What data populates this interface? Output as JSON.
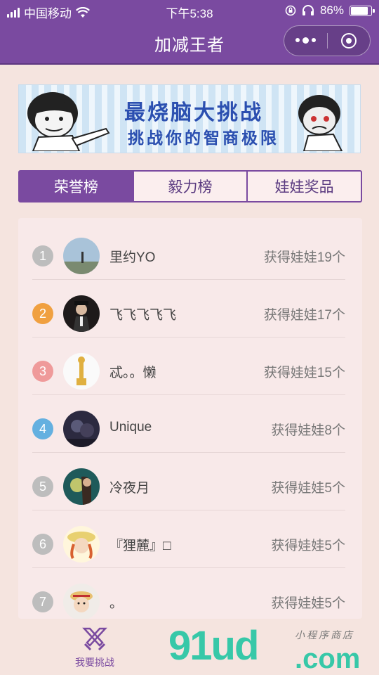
{
  "status_bar": {
    "carrier": "中国移动",
    "time": "下午5:38",
    "battery": "86%",
    "battery_level": 0.86
  },
  "nav": {
    "title": "加减王者"
  },
  "banner": {
    "title": "最烧脑大挑战",
    "subtitle": "挑战你的智商极限"
  },
  "tabs": [
    "荣誉榜",
    "毅力榜",
    "娃娃奖品"
  ],
  "ranking": [
    {
      "rank": "1",
      "name": "里约YO",
      "prize": "获得娃娃19个"
    },
    {
      "rank": "2",
      "name": "飞飞飞飞飞",
      "prize": "获得娃娃17个"
    },
    {
      "rank": "3",
      "name": "忒。。懒",
      "prize": "获得娃娃15个"
    },
    {
      "rank": "4",
      "name": "Unique",
      "prize": "获得娃娃8个"
    },
    {
      "rank": "5",
      "name": "冷夜月",
      "prize": "获得娃娃5个"
    },
    {
      "rank": "6",
      "name": "『狸麓』□",
      "prize": "获得娃娃5个"
    },
    {
      "rank": "7",
      "name": "。",
      "prize": "获得娃娃5个"
    }
  ],
  "tabbar": {
    "challenge_label": "我要挑战"
  },
  "watermark": {
    "main": "91ud",
    "dot_com": ".com",
    "sub": "小程序商店"
  },
  "colors": {
    "primary": "#7a4aa0",
    "background": "#f5e4df",
    "rank_gray": "#bdbdbd",
    "rank_orange": "#f0a040",
    "rank_pink": "#ef9a9a",
    "rank_blue": "#64b0e0"
  }
}
